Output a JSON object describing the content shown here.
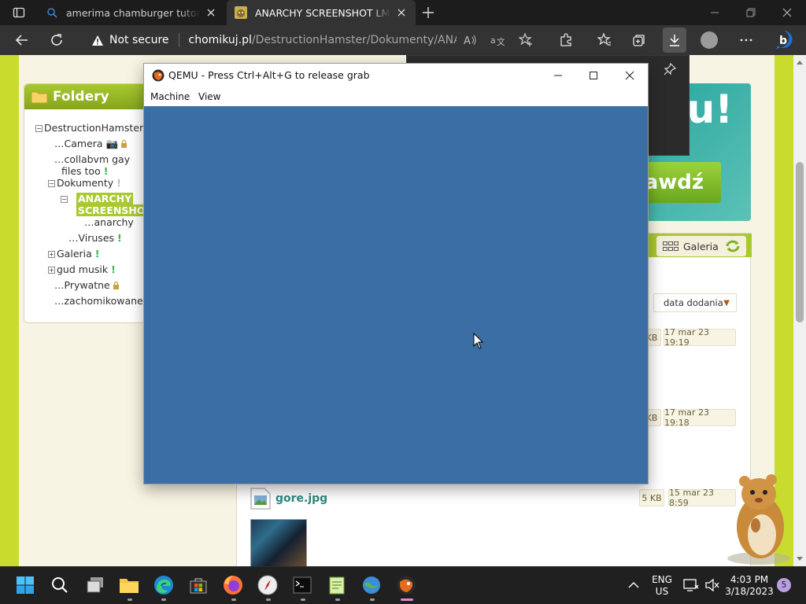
{
  "browser": {
    "tabs": [
      {
        "title": "amerima chamburger tutoral - Sc",
        "icon": "search-icon"
      },
      {
        "title": "ANARCHY SCREENSHOT LMAO -",
        "icon": "hamster-favicon",
        "active": true
      }
    ],
    "address": {
      "security": "Not secure",
      "host": "chomikuj.pl",
      "path": "/DestructionHamster/Dokumenty/ANARC..."
    }
  },
  "page": {
    "foldery": {
      "title": "Foldery",
      "items": [
        {
          "label": "DestructionHamster"
        },
        {
          "label": "Camera"
        },
        {
          "label": "collabvm gay"
        },
        {
          "label": "files too"
        },
        {
          "label": "Dokumenty"
        },
        {
          "label": "ANARCHY"
        },
        {
          "label": "SCREENSHOT"
        },
        {
          "label": "anarchy"
        },
        {
          "label": "Viruses"
        },
        {
          "label": "Galeria"
        },
        {
          "label": "gud musik"
        },
        {
          "label": "Prywatne"
        },
        {
          "label": "zachomikowane"
        }
      ]
    },
    "promo": {
      "big_text": "ru!",
      "button_label": "awdź"
    },
    "gallery_button": "Galeria",
    "sort": {
      "label": "data dodania",
      "arrow": "▼"
    },
    "files": [
      {
        "size": "KB",
        "date": "17 mar 23 19:19"
      },
      {
        "size": "KB",
        "date": "17 mar 23 19:18"
      },
      {
        "name": "gore.jpg",
        "size": "5 KB",
        "date": "15 mar 23 8:59"
      }
    ]
  },
  "qemu": {
    "title": "QEMU - Press Ctrl+Alt+G to release grab",
    "menu": [
      "Machine",
      "View"
    ],
    "screen_color": "#3b6ea5"
  },
  "taskbar": {
    "lang_line1": "ENG",
    "lang_line2": "US",
    "time": "4:03 PM",
    "date": "3/18/2023",
    "notification_count": "5"
  },
  "colors": {
    "page_bg": "#c9dc2e",
    "accent_green": "#a9c930",
    "browser_chrome": "#333333",
    "qemu_screen": "#3b6ea5"
  }
}
